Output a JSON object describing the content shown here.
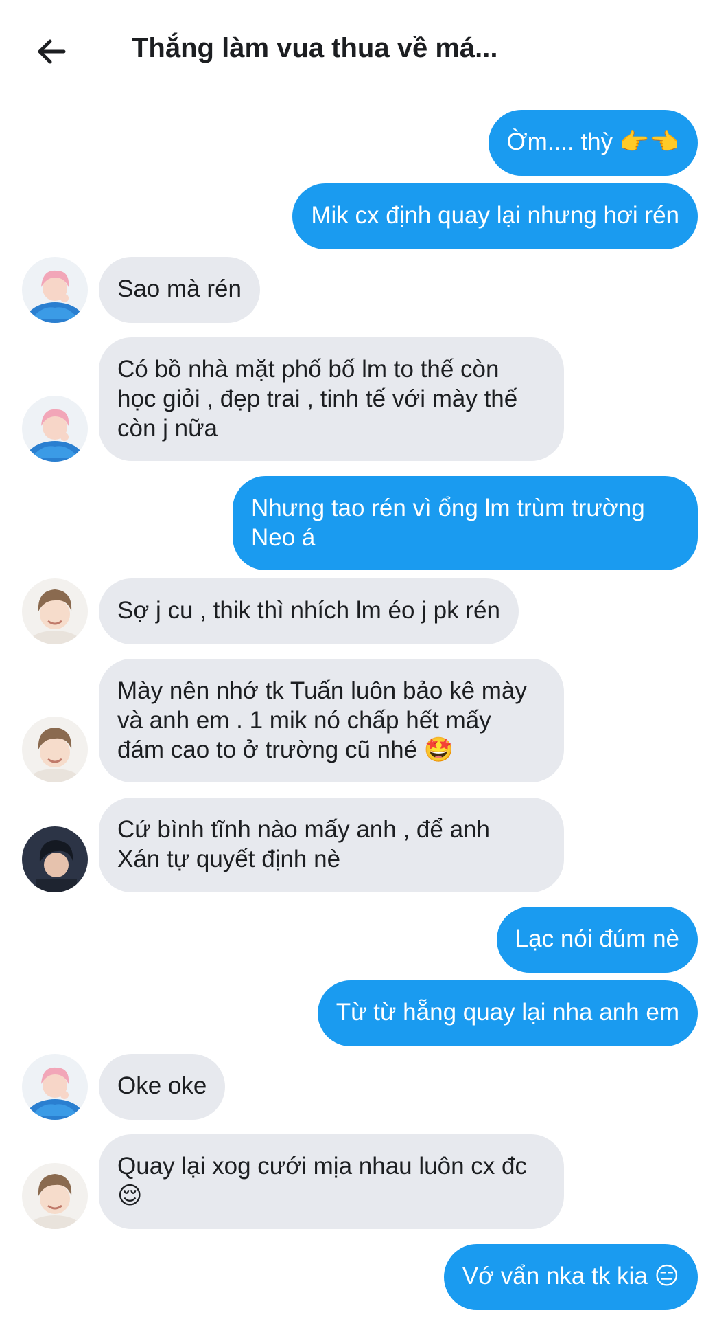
{
  "header": {
    "title": "Thắng làm vua thua về má..."
  },
  "messages": [
    {
      "text": "Ờm.... thỳ 👉👈"
    },
    {
      "text": "Mik cx định quay lại nhưng hơi rén"
    },
    {
      "text": "Sao mà rén"
    },
    {
      "text": "Có bồ nhà mặt phố bố lm to thế còn\nhọc giỏi , đẹp trai , tinh tế với mày thế\ncòn j nữa"
    },
    {
      "text": "Nhưng tao rén vì ổng lm trùm trường\nNeo á"
    },
    {
      "text": "Sợ j cu , thik thì nhích lm éo j pk rén"
    },
    {
      "text": "Mày nên nhớ tk Tuấn luôn bảo kê mày\nvà anh em . 1 mik nó chấp hết mấy\nđám cao to ở trường cũ nhé 🤩"
    },
    {
      "text": "Cứ bình tĩnh nào mấy anh , để anh\nXán tự quyết định nè"
    },
    {
      "text": "Lạc nói đúm nè"
    },
    {
      "text": "Từ từ hẵng quay lại nha anh em"
    },
    {
      "text": "Oke oke"
    },
    {
      "text": "Quay lại xog cưới mịa nhau luôn cx đc\n😌"
    },
    {
      "text": "Vớ vẩn nka tk kia 😑"
    }
  ],
  "colors": {
    "outgoing_bubble": "#1a9bf0",
    "incoming_bubble": "#e7e9ee"
  },
  "icons": {
    "back": "arrow-left-icon",
    "avatars": [
      "avatar-pink-hair",
      "avatar-smiling-boy",
      "avatar-dark-hair"
    ]
  }
}
